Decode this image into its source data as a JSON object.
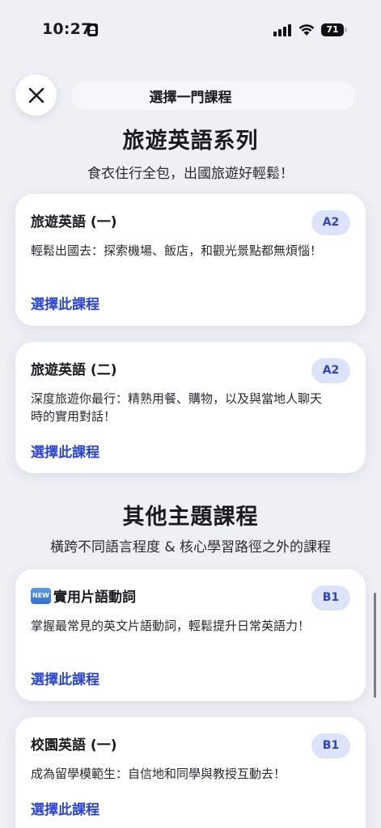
{
  "status_bar": {
    "time": "10:27",
    "battery": "71"
  },
  "header": {
    "title": "選擇一門課程",
    "close_icon": "close-icon"
  },
  "sections": [
    {
      "title": "旅遊英語系列",
      "subtitle": "食衣住行全包，出國旅遊好輕鬆！",
      "courses": [
        {
          "title": "旅遊英語 (一)",
          "level": "A2",
          "description": "輕鬆出國去：探索機場、飯店，和觀光景點都無煩惱！",
          "action": "選擇此課程"
        },
        {
          "title": "旅遊英語 (二)",
          "level": "A2",
          "description": "深度旅遊你最行：精熟用餐、購物，以及與當地人聊天時的實用對話！",
          "action": "選擇此課程"
        }
      ]
    },
    {
      "title": "其他主題課程",
      "subtitle": "橫跨不同語言程度 & 核心學習路徑之外的課程",
      "courses": [
        {
          "badge": "NEW",
          "title": "實用片語動詞",
          "level": "B1",
          "description": "掌握最常見的英文片語動詞，輕鬆提升日常英語力！",
          "action": "選擇此課程"
        },
        {
          "title": "校園英語 (一)",
          "level": "B1",
          "description": "成為留學模範生：自信地和同學與教授互動去！",
          "action": "選擇此課程"
        }
      ]
    }
  ],
  "colors": {
    "accent": "#2a45d6",
    "badge_bg": "#dde3fa",
    "page_bg": "#eff0f6"
  }
}
